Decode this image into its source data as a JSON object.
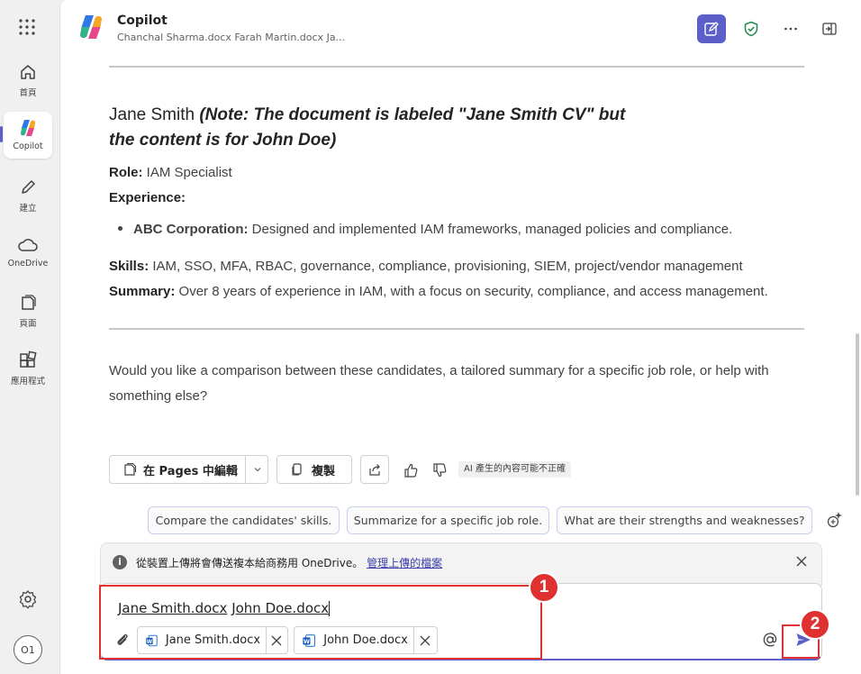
{
  "rail": {
    "items": [
      {
        "label": "首頁",
        "icon": "home-icon"
      },
      {
        "label": "Copilot",
        "icon": "copilot-icon"
      },
      {
        "label": "建立",
        "icon": "pen-icon"
      },
      {
        "label": "OneDrive",
        "icon": "cloud-icon"
      },
      {
        "label": "頁面",
        "icon": "pages-icon"
      },
      {
        "label": "應用程式",
        "icon": "apps-icon"
      }
    ],
    "avatar": "O1"
  },
  "header": {
    "title": "Copilot",
    "subtitle": "Chanchal Sharma.docx Farah Martin.docx Ja..."
  },
  "message": {
    "heading_name": "Jane Smith",
    "heading_note": "(Note: The document is labeled \"Jane Smith CV\" but the content is for John Doe)",
    "role_label": "Role:",
    "role_value": "IAM Specialist",
    "experience_label": "Experience:",
    "bullet_label": "ABC Corporation:",
    "bullet_value": "Designed and implemented IAM frameworks, managed policies and compliance.",
    "skills_label": "Skills:",
    "skills_value": "IAM, SSO, MFA, RBAC, governance, compliance, provisioning, SIEM, project/vendor management",
    "summary_label": "Summary:",
    "summary_value": "Over 8 years of experience in IAM, with a focus on security, compliance, and access management.",
    "followup": "Would you like a comparison between these candidates, a tailored summary for a specific job role, or help with something else?"
  },
  "actions": {
    "edit_pages": "在 Pages 中編輯",
    "copy": "複製",
    "ai_notice": "AI 產生的內容可能不正確"
  },
  "suggestions": [
    "Compare the candidates' skills.",
    "Summarize for a specific job role.",
    "What are their strengths and weaknesses?"
  ],
  "notice": {
    "text": "從裝置上傳將會傳送複本給商務用 OneDrive。",
    "link": "管理上傳的檔案"
  },
  "composer": {
    "ref1": "Jane Smith.docx",
    "ref2": "John Doe.docx",
    "files": [
      "Jane Smith.docx",
      "John Doe.docx"
    ]
  },
  "annotations": [
    "1",
    "2"
  ],
  "colors": {
    "accent": "#5b5fc7",
    "annotation": "#e03131"
  }
}
